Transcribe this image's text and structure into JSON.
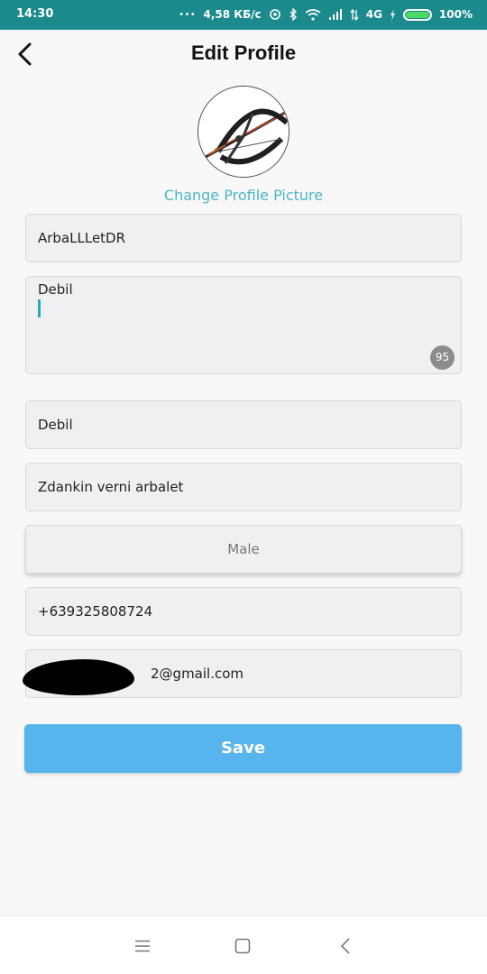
{
  "status_bar": {
    "time": "14:30",
    "dots": "...",
    "speed": "4,58 КБ/с",
    "network": "4G",
    "battery": "100%",
    "battery_color": "#4cd964"
  },
  "header": {
    "title": "Edit Profile",
    "back_icon": "chevron-left-icon"
  },
  "profile": {
    "change_picture_label": "Change Profile Picture"
  },
  "form": {
    "username": "ArbaLLLetDR",
    "bio": "Debil",
    "bio_counter": "95",
    "name": "Debil",
    "description": "Zdankin verni arbalet",
    "gender": "Male",
    "phone": "+639325808724",
    "email_visible": "2@gmail.com"
  },
  "save_label": "Save",
  "colors": {
    "accent": "#4bb5c1",
    "save_button": "#58b4ec",
    "status_bar": "#1a8a8c"
  },
  "nav": {
    "icons": [
      "menu-icon",
      "home-square-icon",
      "back-icon"
    ]
  }
}
